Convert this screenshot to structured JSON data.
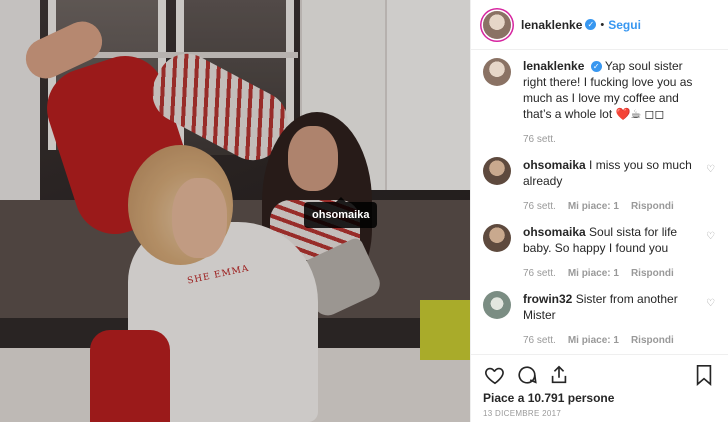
{
  "header": {
    "username": "lenaklenke",
    "separator": "•",
    "follow_label": "Segui"
  },
  "photo": {
    "tag_label": "ohsomaika",
    "shirt_text": "SHE EMMA"
  },
  "caption": {
    "username": "lenaklenke",
    "text": "Yap soul sister right there! I fucking love you as much as I love my coffee and that’s a whole lot ❤️☕ ◻◻",
    "time": "76 sett."
  },
  "comments": [
    {
      "username": "ohsomaika",
      "text": "I miss you so much already",
      "time": "76 sett.",
      "likes": "Mi piace: 1",
      "reply": "Rispondi"
    },
    {
      "username": "ohsomaika",
      "text": "Soul sista for life baby. So happy I found you",
      "time": "76 sett.",
      "likes": "Mi piace: 1",
      "reply": "Rispondi"
    },
    {
      "username": "frowin32",
      "text": "Sister from another Mister",
      "time": "76 sett.",
      "likes": "Mi piace: 1",
      "reply": "Rispondi"
    }
  ],
  "footer": {
    "likes_text": "Piace a 10.791 persone",
    "date_text": "13 DICEMBRE 2017"
  },
  "icons": [
    "heart-icon",
    "comment-icon",
    "share-icon",
    "bookmark-icon",
    "verified-icon",
    "small-heart-icon"
  ],
  "colors": {
    "accent": "#3897f0",
    "meta": "#999999",
    "tag_bg": "#000000",
    "shirt_red": "#b81c1c"
  }
}
